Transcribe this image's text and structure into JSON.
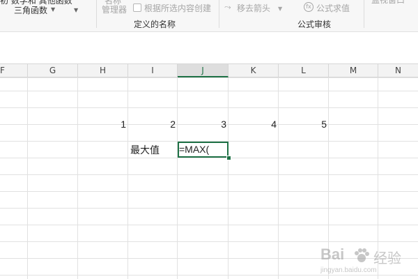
{
  "ribbon": {
    "truncated_top_left": "初 数学和 其他函数",
    "trig_functions": "三角函数",
    "name_manager_top": "名称",
    "name_manager": "管理器",
    "create_from_selection": "根据所选内容创建",
    "remove_arrows": "移去箭头",
    "evaluate_formula": "公式求值",
    "watch_window_top": "监视窗口",
    "group_defined_names": "定义的名称",
    "group_formula_auditing": "公式审核",
    "icons": {
      "create": "table-icon",
      "remove_arrows": "arrows-icon",
      "evaluate": "fx-icon"
    }
  },
  "columns": [
    "F",
    "G",
    "H",
    "I",
    "J",
    "K",
    "L",
    "M",
    "N"
  ],
  "active_column": "J",
  "cells": {
    "h_row": "1",
    "i_row": "2",
    "j_row": "3",
    "k_row": "4",
    "l_row": "5",
    "label_max": "最大值",
    "formula": "=MAX("
  },
  "watermark": {
    "brand": "Bai",
    "brand2": "经验",
    "url": "jingyan.baidu.com"
  },
  "colors": {
    "accent_green": "#1e7145",
    "grid": "#e1e1e1",
    "header_bg": "#f3f3f3"
  }
}
